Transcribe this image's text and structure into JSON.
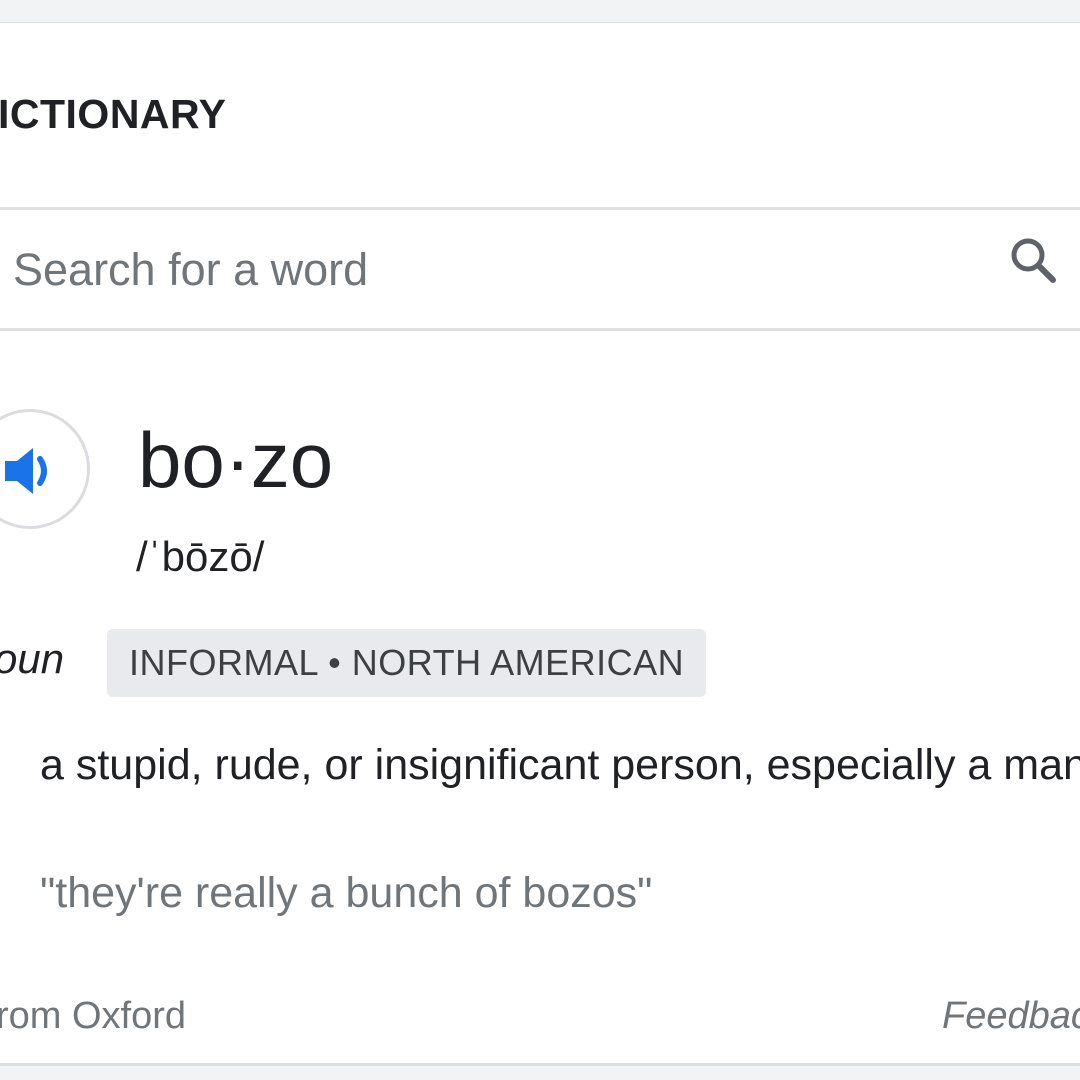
{
  "card": {
    "title": "ICTIONARY"
  },
  "search": {
    "placeholder": "Search for a word",
    "value": "",
    "icon": "search-icon"
  },
  "entry": {
    "audio_icon": "speaker-icon",
    "headword": "bo·zo",
    "phonetic": "/ˈbōzō/",
    "part_of_speech": "oun",
    "label": "INFORMAL • NORTH AMERICAN",
    "definition": "a stupid, rude, or insignificant person, especially a man.",
    "example": "\"they're really a bunch of bozos\""
  },
  "footer": {
    "source": "rom Oxford",
    "feedback": "Feedbac"
  },
  "colors": {
    "accent_blue": "#1a73e8",
    "text_primary": "#202124",
    "text_secondary": "#70757a",
    "chip_background": "#e8eaed"
  }
}
